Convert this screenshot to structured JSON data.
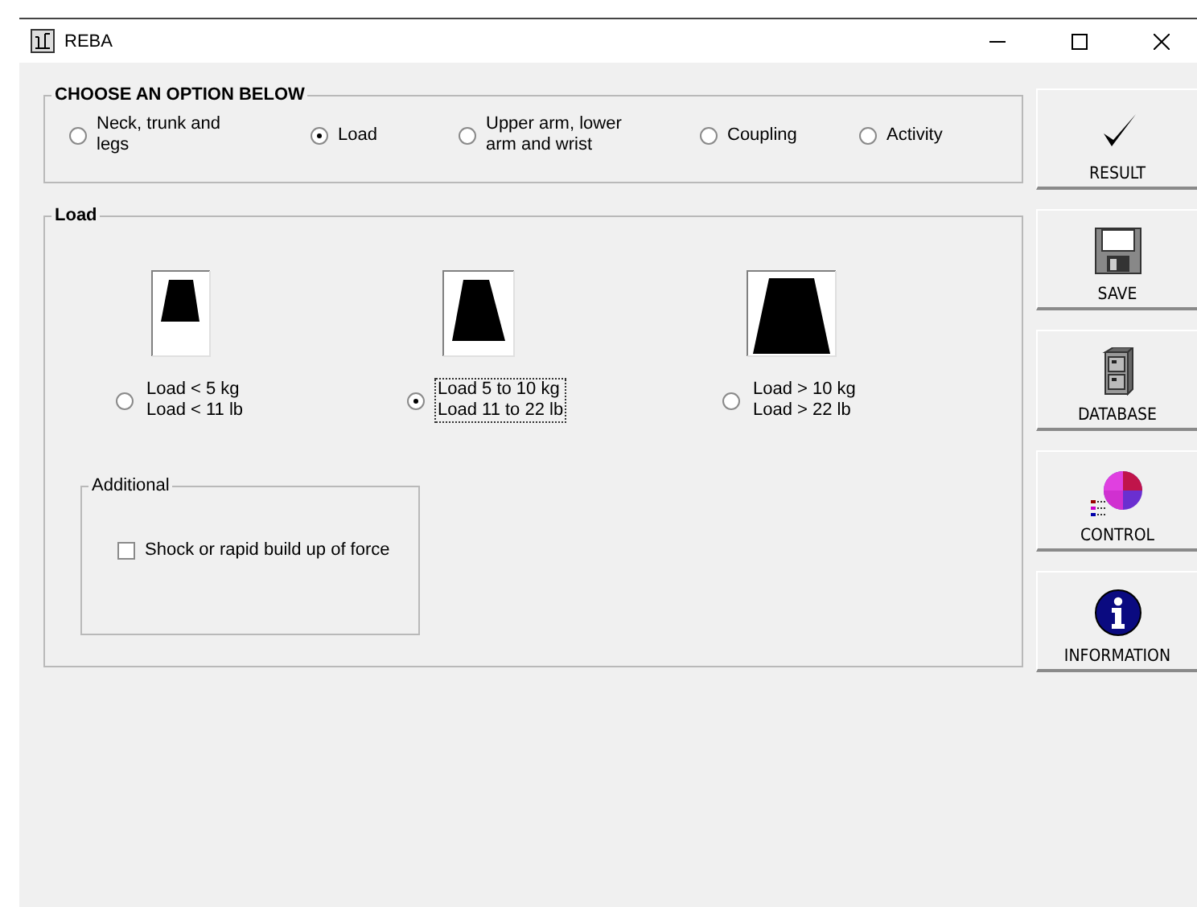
{
  "window": {
    "title": "REBA"
  },
  "options": {
    "legend": "CHOOSE AN OPTION BELOW",
    "items": [
      {
        "label": "Neck, trunk and legs",
        "selected": false
      },
      {
        "label": "Load",
        "selected": true
      },
      {
        "label": "Upper arm, lower arm and wrist",
        "selected": false
      },
      {
        "label": "Coupling",
        "selected": false
      },
      {
        "label": "Activity",
        "selected": false
      }
    ]
  },
  "load": {
    "legend": "Load",
    "items": [
      {
        "kind": "small",
        "lines": [
          "Load < 5 kg",
          "Load < 11 lb"
        ],
        "selected": false,
        "focused": false
      },
      {
        "kind": "medium",
        "lines": [
          "Load 5 to 10 kg",
          "Load 11 to 22 lb"
        ],
        "selected": true,
        "focused": true
      },
      {
        "kind": "large",
        "lines": [
          "Load > 10 kg",
          "Load > 22 lb"
        ],
        "selected": false,
        "focused": false
      }
    ],
    "additional": {
      "legend": "Additional",
      "items": [
        {
          "label": "Shock or rapid build up of force",
          "checked": false
        }
      ]
    }
  },
  "sidebar": [
    {
      "kind": "result",
      "label": "RESULT"
    },
    {
      "kind": "save",
      "label": "SAVE"
    },
    {
      "kind": "database",
      "label": "DATABASE"
    },
    {
      "kind": "control",
      "label": "CONTROL"
    },
    {
      "kind": "information",
      "label": "INFORMATION"
    }
  ]
}
